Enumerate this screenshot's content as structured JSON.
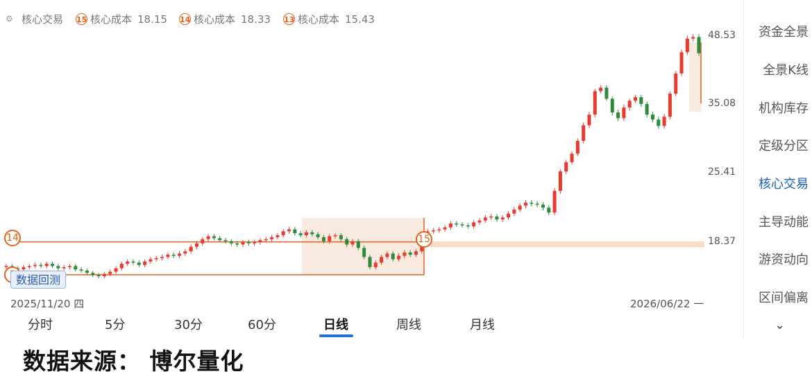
{
  "legend": {
    "title": "核心交易",
    "items": [
      {
        "badge": "15",
        "label": "核心成本",
        "value": "18.15"
      },
      {
        "badge": "14",
        "label": "核心成本",
        "value": "18.33"
      },
      {
        "badge": "13",
        "label": "核心成本",
        "value": "15.43"
      }
    ]
  },
  "price_axis": [
    "48.53",
    "35.08",
    "25.41",
    "18.37"
  ],
  "markers": {
    "left": "14",
    "mid": "15",
    "bottom": "1"
  },
  "backtest_label": "数据回测",
  "dates": {
    "start": "2025/11/20 四",
    "end": "2026/06/22 一"
  },
  "tabs": [
    "分时",
    "5分",
    "30分",
    "60分",
    "日线",
    "周线",
    "月线"
  ],
  "active_tab": "日线",
  "sidebar": [
    "资金全景",
    "全景K线",
    "机构库存",
    "定级分区",
    "核心交易",
    "主导动能",
    "游资动向",
    "区间偏离"
  ],
  "active_sidebar": "核心交易",
  "footer": "数据来源： 博尔量化",
  "colors": {
    "up": "#e63b2e",
    "down": "#2e8b3a",
    "accent": "#e5621b",
    "active_blue": "#1a5fb4"
  },
  "chart_data": {
    "type": "candlestick",
    "price_labels": [
      48.53,
      35.08,
      25.41,
      18.37
    ],
    "cost_lines": [
      18.15,
      18.33,
      15.43
    ],
    "closes": [
      16.2,
      16.0,
      15.9,
      16.1,
      16.2,
      16.3,
      16.2,
      16.4,
      16.2,
      16.0,
      16.1,
      16.2,
      15.9,
      15.8,
      15.6,
      15.4,
      15.3,
      15.5,
      15.7,
      16.0,
      16.4,
      16.6,
      16.5,
      16.3,
      16.6,
      16.8,
      16.9,
      17.0,
      17.2,
      17.1,
      17.3,
      17.5,
      17.9,
      18.2,
      18.6,
      18.9,
      18.7,
      18.5,
      18.4,
      18.2,
      18.1,
      18.3,
      18.2,
      18.3,
      18.5,
      18.6,
      18.8,
      19.0,
      19.4,
      19.6,
      19.2,
      19.0,
      19.3,
      19.1,
      18.8,
      18.4,
      18.9,
      19.0,
      18.6,
      18.1,
      18.4,
      17.8,
      17.0,
      16.1,
      16.5,
      17.0,
      17.3,
      16.8,
      17.1,
      17.4,
      17.2,
      17.5,
      18.3,
      19.4,
      19.5,
      19.6,
      19.8,
      20.2,
      20.1,
      20.0,
      19.9,
      20.3,
      20.5,
      20.8,
      20.9,
      20.6,
      20.8,
      21.2,
      21.6,
      22.0,
      22.3,
      22.2,
      22.1,
      21.8,
      21.3,
      23.5,
      25.5,
      26.8,
      28.0,
      29.8,
      32.0,
      33.5,
      37.5,
      38.2,
      36.0,
      33.8,
      33.0,
      34.5,
      35.6,
      36.3,
      35.0,
      33.5,
      32.8,
      31.9,
      33.2,
      37.0,
      41.0,
      45.2,
      47.9,
      48.2,
      45.0
    ]
  }
}
